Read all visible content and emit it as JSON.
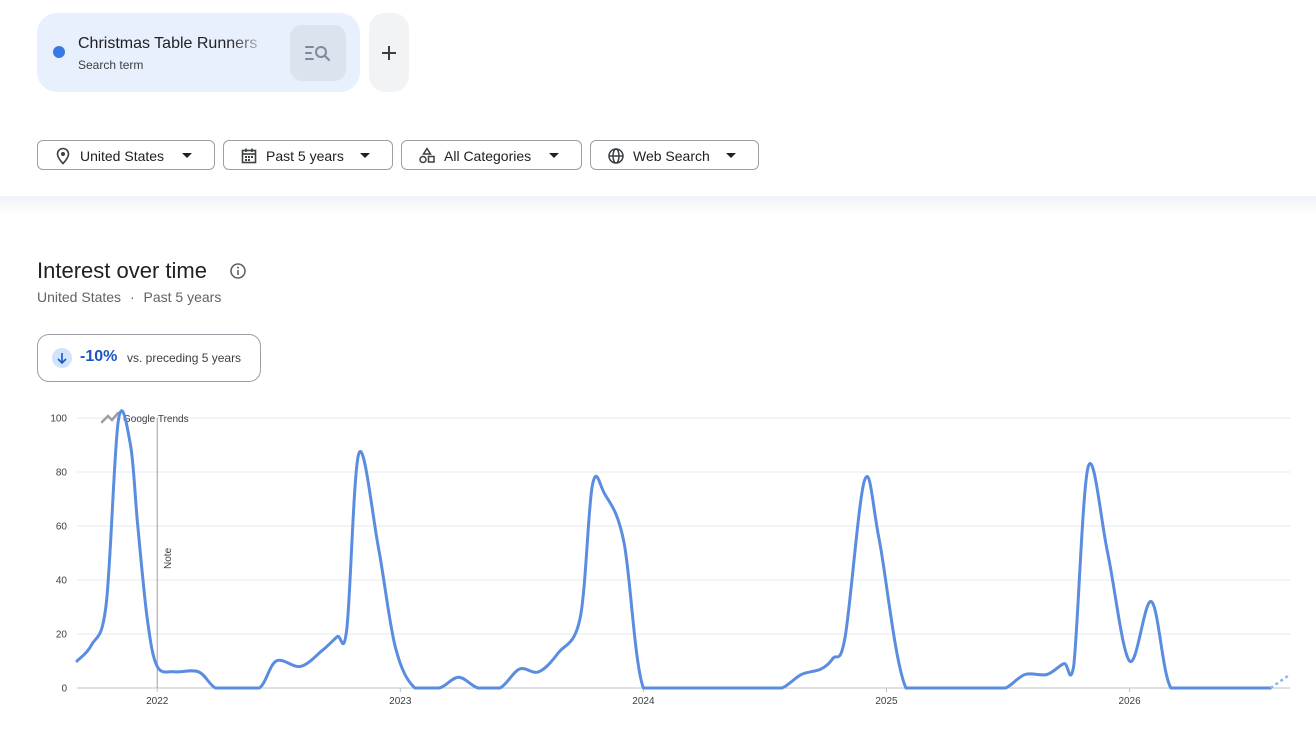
{
  "search": {
    "term": "Christmas Table Runners",
    "type": "Search term",
    "dot_color": "#3b78e7",
    "search_icon": "search-list-icon",
    "add_icon": "plus-icon"
  },
  "filters": [
    {
      "label": "United States",
      "icon": "location-pin-icon"
    },
    {
      "label": "Past 5 years",
      "icon": "calendar-icon"
    },
    {
      "label": "All Categories",
      "icon": "categories-icon"
    },
    {
      "label": "Web Search",
      "icon": "globe-icon"
    }
  ],
  "section": {
    "title": "Interest over time",
    "subtitle_region": "United States",
    "subtitle_sep": "·",
    "subtitle_period": "Past 5 years"
  },
  "comparison": {
    "value": "-10%",
    "text": "vs. preceding 5 years",
    "direction": "down"
  },
  "chart_data": {
    "type": "line",
    "watermark": "Google Trends",
    "note_label": "Note",
    "note_at": 2022.0,
    "line_color": "#5a8ddf",
    "ylim": [
      0,
      100
    ],
    "yticks": [
      0,
      20,
      40,
      60,
      80,
      100
    ],
    "xlim": [
      2021.67,
      2026.66
    ],
    "xticks": [
      {
        "value": 2022,
        "label": "2022"
      },
      {
        "value": 2023,
        "label": "2023"
      },
      {
        "value": 2024,
        "label": "2024"
      },
      {
        "value": 2025,
        "label": "2025"
      },
      {
        "value": 2026,
        "label": "2026"
      }
    ],
    "grid": true,
    "series": [
      {
        "x": [
          2021.67,
          2021.73,
          2021.79,
          2021.84,
          2021.89,
          2021.92,
          2021.96,
          2022.0,
          2022.07,
          2022.17,
          2022.24,
          2022.32,
          2022.42,
          2022.49,
          2022.59,
          2022.68,
          2022.74,
          2022.78,
          2022.83,
          2022.91,
          2022.98,
          2023.06,
          2023.16,
          2023.24,
          2023.32,
          2023.41,
          2023.49,
          2023.57,
          2023.65,
          2023.74,
          2023.79,
          2023.84,
          2023.92,
          2024.0,
          2024.14,
          2024.31,
          2024.42,
          2024.49,
          2024.57,
          2024.65,
          2024.73,
          2024.78,
          2024.83,
          2024.91,
          2024.97,
          2025.08,
          2025.24,
          2025.33,
          2025.42,
          2025.49,
          2025.57,
          2025.66,
          2025.73,
          2025.77,
          2025.83,
          2025.91,
          2026.0,
          2026.09,
          2026.17,
          2026.3,
          2026.47,
          2026.58
        ],
        "y": [
          10,
          16,
          31,
          99,
          90,
          60,
          25,
          8,
          6,
          6,
          0,
          0,
          0,
          10,
          8,
          14,
          19,
          22,
          87,
          52,
          15,
          0,
          0,
          4,
          0,
          0,
          7,
          6,
          13,
          26,
          75,
          72,
          54,
          0,
          0,
          0,
          0,
          0,
          0,
          5,
          7,
          11,
          19,
          77,
          55,
          0,
          0,
          0,
          0,
          0,
          5,
          5,
          9,
          8,
          82,
          50,
          10,
          32,
          0,
          0,
          0,
          0
        ]
      }
    ],
    "partial_x": [
      2026.58,
      2026.66
    ],
    "partial_y": [
      0,
      5
    ]
  }
}
